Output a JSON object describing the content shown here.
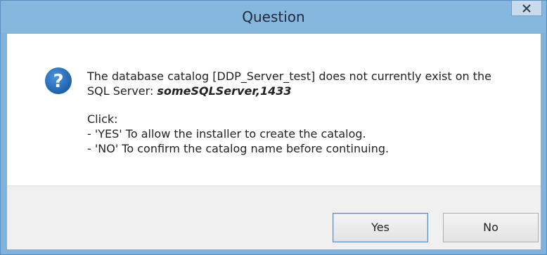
{
  "window": {
    "title": "Question"
  },
  "message": {
    "line1": "The database catalog [DDP_Server_test] does not currently exist on the",
    "line2_prefix": "SQL Server: ",
    "server_name": "someSQLServer,1433",
    "click_label": "Click:",
    "yes_instruction": "- 'YES' To allow the installer to create the catalog.",
    "no_instruction": "- 'NO' To confirm the catalog name before continuing."
  },
  "buttons": {
    "yes_label": "Yes",
    "no_label": "No"
  },
  "icons": {
    "question": "question-icon",
    "close": "close-icon"
  },
  "colors": {
    "title_bar": "#86b8df",
    "question_icon": "#2a70c2",
    "footer": "#f0f0f0"
  }
}
